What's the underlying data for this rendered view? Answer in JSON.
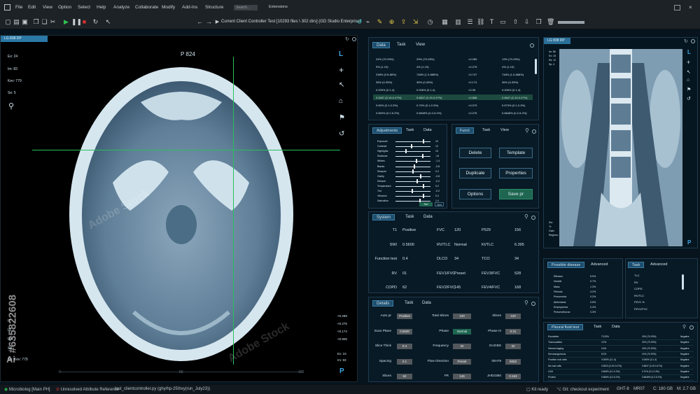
{
  "menu": {
    "items": [
      "File",
      "Edit",
      "View",
      "Option",
      "Select",
      "Help",
      "Analyze",
      "Collaborate",
      "Modify",
      "Add-Ins",
      "Structure"
    ],
    "search_placeholder": "Search...",
    "extensions": "Extensions"
  },
  "toolbar": {
    "client_title": "Current Client Controller Test [10293 files \\ 302 dirs] (GD Studio Enterprise)"
  },
  "ct_view": {
    "tab_label": "LG 838 DP",
    "slice_label": "P 824",
    "orient_top": "L",
    "orient_bottom": "P",
    "info_tl": [
      "Ex: 24",
      "Im: 83",
      "Kev: 779",
      "Se: 5"
    ],
    "info_bl": [
      "IT",
      "IS",
      "Uw",
      "Se",
      "Se: Kev: 779"
    ],
    "info_right": [
      "<0.289",
      "<0.275",
      "<0.174",
      "<0.805"
    ],
    "info_br": [
      "Ex: 24",
      "Im: 83"
    ],
    "ruler": [
      "0",
      "50",
      "100"
    ],
    "watermark_id": "#635822608",
    "watermark_brand": "Adobe Stock"
  },
  "data_panel": {
    "tabs": [
      "Data",
      "Task",
      "View"
    ],
    "rows": [
      [
        "24% (70-93%)",
        "29% (70-93%)",
        "<0.289",
        "13% (70-93%)"
      ],
      [
        "9% (1-19)",
        "4% (1-19)",
        "<0.275",
        "4% (1-19)"
      ],
      [
        "238% (0.8-88%)",
        "748% (1.0-888%)",
        "<0.747",
        "748% (1.0-888%)"
      ],
      [
        "36% (0-35%)",
        "36% (0-35%)",
        "<0.174",
        "36% (0-35%)"
      ],
      [
        "0.009% (0.1-4)",
        "0.006% (0.1-4)",
        "<0.35",
        "0.006% (0.1-4)"
      ],
      [
        "0.5467 (0.19-0.47%)",
        "0.6847 (0.19-0.47%)",
        "<0.868",
        "0.6847 (0.19-0.47%)"
      ],
      [
        "0.60% (0.1-0.3%)",
        "0.70% (0.1-0.3%)",
        "<0.079",
        "0.673% (0.1-0.3%)"
      ],
      [
        "0.563% (0.2-5.2%)",
        "0.6848% (0.2-5.2%)",
        "<0.276",
        "0.6848% (0.2-5.2%)"
      ]
    ]
  },
  "adjustments": {
    "tabs": [
      "Adjustments",
      "Task",
      "Data"
    ],
    "rows": [
      {
        "label": "Exposure",
        "value": "10",
        "pos": 0.82
      },
      {
        "label": "Contrast",
        "value": "12",
        "pos": 0.45
      },
      {
        "label": "Highlights",
        "value": "13",
        "pos": 0.3
      },
      {
        "label": "Shadows",
        "value": "-14",
        "pos": 0.8
      },
      {
        "label": "Whites",
        "value": "-1.4",
        "pos": 0.6
      },
      {
        "label": "Blacks",
        "value": "-0.8",
        "pos": 0.55
      },
      {
        "label": "Sharpen",
        "value": "0.2",
        "pos": 0.5
      },
      {
        "label": "Clarity",
        "value": "-0.8",
        "pos": 0.72
      },
      {
        "label": "Dehaze",
        "value": "-0.2",
        "pos": 0.62
      },
      {
        "label": "Temperature",
        "value": "0.2",
        "pos": 0.82
      },
      {
        "label": "Tint",
        "value": "-0.2",
        "pos": 0.48
      },
      {
        "label": "Vibrance",
        "value": "0.4",
        "pos": 0.82
      },
      {
        "label": "Saturation",
        "value": "1.4",
        "pos": 0.7
      }
    ],
    "button_a": "Set",
    "button_b": "Get"
  },
  "funct_panel": {
    "tabs": [
      "Funct",
      "Task",
      "View"
    ],
    "buttons": [
      "Delete",
      "Template",
      "Duplicate",
      "Properties",
      "Options",
      "Save pr"
    ]
  },
  "system_panel": {
    "tabs": [
      "System",
      "Task",
      "Data"
    ],
    "rows": [
      [
        "T1",
        "Positive",
        "FVC",
        "120",
        "P529",
        "156"
      ],
      [
        "SWI",
        "0.5600",
        "RV/TLC",
        "Normal",
        "KI/TLC",
        "6.395"
      ],
      [
        "Function test",
        "0.4",
        "DLCO",
        "34",
        "TCO",
        "34"
      ],
      [
        "RV",
        "01",
        "FEV1/FVC",
        "Preset",
        "FEV3/FVC",
        "528"
      ],
      [
        "COPD",
        "62",
        "FEV2/FVC",
        "145",
        "FEV4/FVC",
        "168"
      ]
    ]
  },
  "details_panel": {
    "tabs": [
      "Details",
      "Task",
      "Data"
    ],
    "rows": [
      [
        "Auto pr",
        "Positive",
        "Total Slices",
        "120",
        "Slices",
        "120"
      ],
      [
        "Scan Plane",
        "0.5600",
        "Phase",
        "Normal",
        "Phase III",
        "0.31"
      ],
      [
        "Slice Thick",
        "0.4",
        "Frequency",
        "34",
        "GUGBS",
        "32"
      ],
      [
        "Spacing",
        "0.1",
        "Flow Direction",
        "Preset",
        "IDH78",
        "8263"
      ],
      [
        "Slices",
        "62",
        "FR",
        "145",
        "JHD2380",
        "0.163"
      ]
    ]
  },
  "mri_view": {
    "tab_label": "LG 838 DP",
    "info_tl": [
      "Im: 86",
      "Ex: 15",
      "Rs: 12",
      "Sp: 4"
    ],
    "info_bl": [
      "Sw:",
      "Tr:",
      "Gain:",
      "Regions:"
    ],
    "orient": "L",
    "orient_bottom": "P"
  },
  "possible_disease": {
    "tabs": [
      "Possible disease",
      "Advanced"
    ],
    "rows": [
      [
        "Effusion",
        "5.9%"
      ],
      [
        "Nodule",
        "0.7%"
      ],
      [
        "Mass",
        "1.3%"
      ],
      [
        "Fibrosis",
        "4.2%"
      ],
      [
        "Pneumonia",
        "0.2%"
      ],
      [
        "Atelectasis",
        "3.5%"
      ],
      [
        "Emphysema",
        "0.4%"
      ],
      [
        "Pneumothorax",
        "0.3%"
      ]
    ]
  },
  "task_panel": {
    "tabs": [
      "Task",
      "Advanced"
    ],
    "items": [
      "TLC",
      "RV",
      "COPD",
      "RV/TLC",
      "FEV1 %",
      "FEV1/FVC"
    ]
  },
  "pleural_panel": {
    "tabs": [
      "Pleural fluid test",
      "Task",
      "Data"
    ],
    "rows": [
      [
        "Exudative",
        "73.25%",
        "15% (70-93%)",
        "Negative"
      ],
      [
        "Transudative",
        "3.2%",
        "24% (70-93%)",
        "Negative"
      ],
      [
        "Hemorrhaging",
        "0.6%",
        "15% (70-93%)",
        "Negative"
      ],
      [
        "Serosanguinous",
        "8.2%",
        "14% (70-93%)",
        "Negative"
      ],
      [
        "Positive mal cells",
        "0.006% (0.1-4)",
        "0.006% (0.1-4)",
        "Negative"
      ],
      [
        "No mal cells",
        "0.5523 (0.19-0.47%)",
        "0.6847 (0.19-0.47%)",
        "Negative"
      ],
      [
        "LDH",
        "0.608% (0.1-0.3%)",
        "0.70% (0.1-0.3%)",
        "Negative"
      ],
      [
        "Protein",
        "0.568% (0.2-5.2%)",
        "0.6848% (0.2-5.2%)",
        "Negative"
      ]
    ]
  },
  "status": {
    "branch": "Microbiolog [Main PH]",
    "unsaved": "Unresolved Attribute Reference",
    "file": "test_clientcontroller.py (ghy/hp-25\\hxy(run_July23))",
    "kit": "Kit ready",
    "git": "Git: checkout experiment",
    "ght": "GHT-8",
    "mr": "MR07",
    "disk_c": "C: 180 GB",
    "disk_m": "M: 2.7 GB"
  },
  "colors": {
    "accent": "#2a6f98",
    "crosshair": "#27c05a",
    "save": "#1e6650"
  }
}
